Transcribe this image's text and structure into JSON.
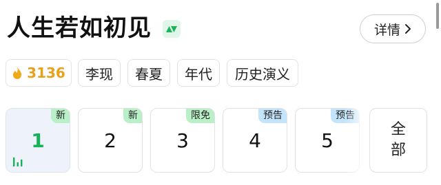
{
  "header": {
    "title": "人生若如初见",
    "vip_icon": "vip-play-badge-icon",
    "detail_button_label": "详情",
    "detail_icon": "chevron-right-icon"
  },
  "tags": {
    "heat": {
      "icon": "flame-icon",
      "value": "3136",
      "color": "#e7a11d"
    },
    "items": [
      "李现",
      "春夏",
      "年代",
      "历史演义"
    ]
  },
  "episodes": [
    {
      "number": "1",
      "badge": "新",
      "badge_color": "#b9f0c7",
      "active": true,
      "playing_icon": "playing-bars-icon"
    },
    {
      "number": "2",
      "badge": "新",
      "badge_color": "#b9f0c7",
      "active": false
    },
    {
      "number": "3",
      "badge": "限免",
      "badge_color": "#b9f0c7",
      "active": false
    },
    {
      "number": "4",
      "badge": "预告",
      "badge_color": "#c4e4fb",
      "active": false
    },
    {
      "number": "5",
      "badge": "预告",
      "badge_color": "#c4e4fb",
      "active": false
    }
  ],
  "all_episodes": {
    "line1": "全",
    "line2": "部"
  },
  "colors": {
    "accent_green": "#19b05a",
    "active_tile_bg": "#eef2fb"
  }
}
